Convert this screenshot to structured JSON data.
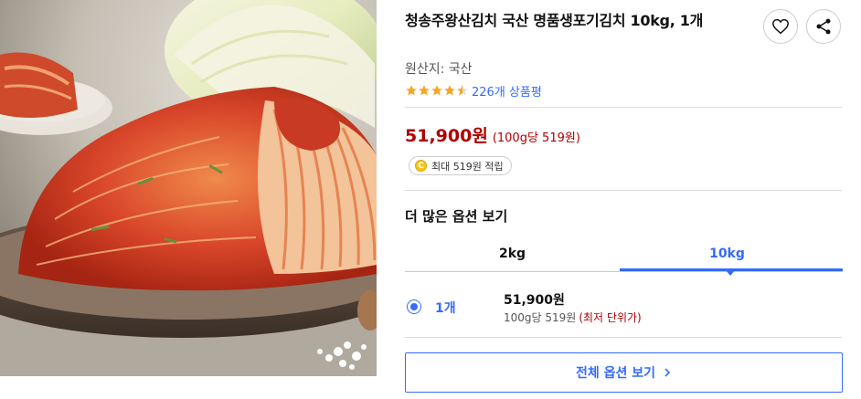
{
  "product": {
    "title": "청송주왕산김치 국산 명품생포기김치 10kg, 1개",
    "origin": "원산지: 국산",
    "rating": 4.5,
    "review_count": "226개 상품평",
    "price": "51,900원",
    "unit_price": "(100g당 519원)",
    "point_badge": "최대 519원 적립",
    "coin_symbol": "C"
  },
  "options": {
    "heading": "더 많은 옵션 보기",
    "tabs": [
      {
        "label": "2kg",
        "selected": false
      },
      {
        "label": "10kg",
        "selected": true
      }
    ],
    "row": {
      "qty": "1개",
      "price": "51,900원",
      "unit": "100g당 519원",
      "lowest_tag": "(최저 단위가)",
      "selected": true
    },
    "all_button": "전체 옵션 보기",
    "all_button_icon": "chevron-right-icon"
  },
  "icons": {
    "wishlist": "heart-icon",
    "share": "share-icon",
    "star": "star-icon"
  },
  "colors": {
    "accent": "#346aff",
    "price": "#ae0000",
    "star": "#f5a623"
  }
}
